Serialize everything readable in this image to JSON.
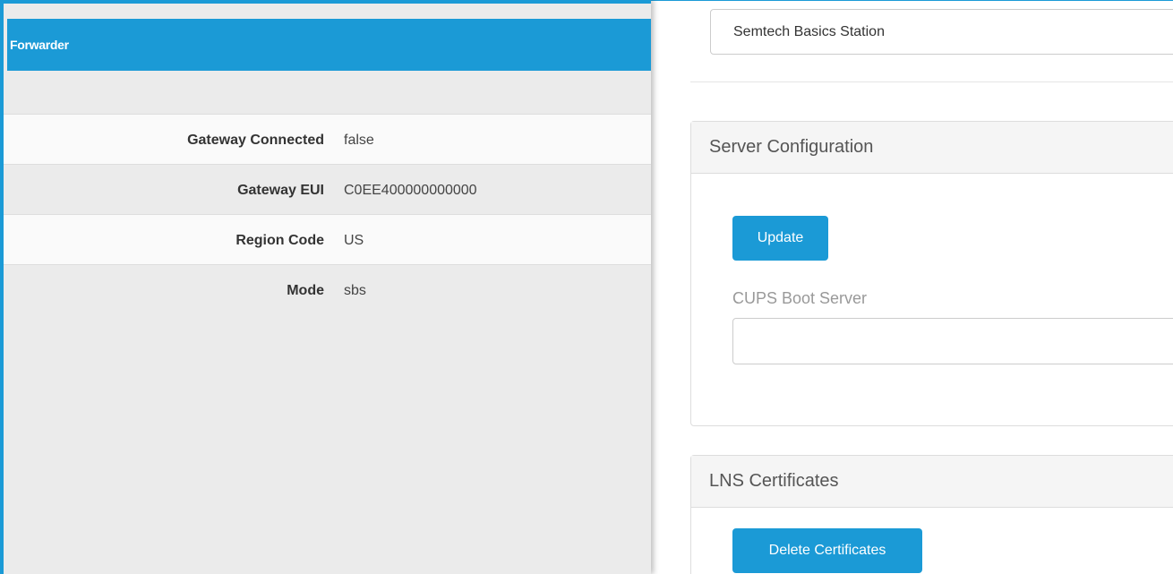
{
  "forwarder_panel": {
    "title": "Forwarder",
    "rows": [
      {
        "label": "Gateway Connected",
        "value": "false"
      },
      {
        "label": "Gateway EUI",
        "value": "C0EE400000000000"
      },
      {
        "label": "Region Code",
        "value": "US"
      },
      {
        "label": "Mode",
        "value": "sbs"
      }
    ]
  },
  "station_select": {
    "selected": "Semtech Basics Station"
  },
  "server_configuration": {
    "heading": "Server Configuration",
    "update_label": "Update",
    "cups_label": "CUPS Boot Server",
    "cups_value": ""
  },
  "lns_certificates": {
    "heading": "LNS Certificates",
    "delete_label": "Delete Certificates"
  },
  "colors": {
    "accent": "#1b9ad6",
    "panel_bg": "#ebebeb",
    "row_light": "#fafafa"
  }
}
